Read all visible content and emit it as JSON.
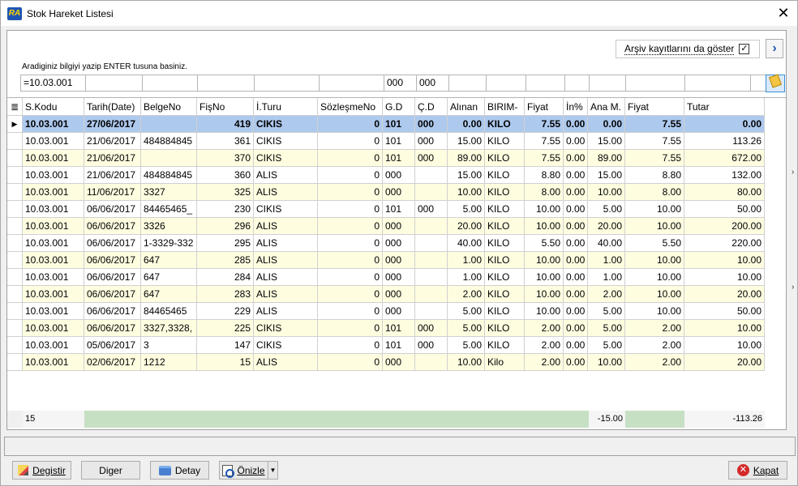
{
  "window": {
    "title": "Stok Hareket Listesi",
    "logo_text": "RA"
  },
  "archive": {
    "label": "Arşiv kayıtlarını da göster",
    "checked_glyph": "☑"
  },
  "hint": "Aradiginiz bilgiyi yazip ENTER tusuna basiniz.",
  "filters": [
    "=10.03.001",
    "",
    "",
    "",
    "",
    "",
    "000",
    "000",
    "",
    "",
    "",
    "",
    "",
    "",
    "",
    ""
  ],
  "columns": [
    "S.Kodu",
    "Tarih(Date)",
    "BelgeNo",
    "FişNo",
    "İ.Turu",
    "SözleşmeNo",
    "G.D",
    "Ç.D",
    "Alınan",
    "BIRIM-",
    "Fiyat",
    "İn%",
    "Ana M.",
    "Fiyat",
    "Tutar"
  ],
  "rows": [
    [
      "10.03.001",
      "27/06/2017",
      "",
      "419",
      "CIKIS",
      "0",
      "101",
      "000",
      "0.00",
      "KILO",
      "7.55",
      "0.00",
      "0.00",
      "7.55",
      "0.00"
    ],
    [
      "10.03.001",
      "21/06/2017",
      "484884845",
      "361",
      "CIKIS",
      "0",
      "101",
      "000",
      "15.00",
      "KILO",
      "7.55",
      "0.00",
      "15.00",
      "7.55",
      "113.26"
    ],
    [
      "10.03.001",
      "21/06/2017",
      "",
      "370",
      "CIKIS",
      "0",
      "101",
      "000",
      "89.00",
      "KILO",
      "7.55",
      "0.00",
      "89.00",
      "7.55",
      "672.00"
    ],
    [
      "10.03.001",
      "21/06/2017",
      "484884845",
      "360",
      "ALIS",
      "0",
      "000",
      "",
      "15.00",
      "KILO",
      "8.80",
      "0.00",
      "15.00",
      "8.80",
      "132.00"
    ],
    [
      "10.03.001",
      "11/06/2017",
      "3327",
      "325",
      "ALIS",
      "0",
      "000",
      "",
      "10.00",
      "KILO",
      "8.00",
      "0.00",
      "10.00",
      "8.00",
      "80.00"
    ],
    [
      "10.03.001",
      "06/06/2017",
      "84465465_",
      "230",
      "CIKIS",
      "0",
      "101",
      "000",
      "5.00",
      "KILO",
      "10.00",
      "0.00",
      "5.00",
      "10.00",
      "50.00"
    ],
    [
      "10.03.001",
      "06/06/2017",
      "3326",
      "296",
      "ALIS",
      "0",
      "000",
      "",
      "20.00",
      "KILO",
      "10.00",
      "0.00",
      "20.00",
      "10.00",
      "200.00"
    ],
    [
      "10.03.001",
      "06/06/2017",
      "1-3329-332",
      "295",
      "ALIS",
      "0",
      "000",
      "",
      "40.00",
      "KILO",
      "5.50",
      "0.00",
      "40.00",
      "5.50",
      "220.00"
    ],
    [
      "10.03.001",
      "06/06/2017",
      "647",
      "285",
      "ALIS",
      "0",
      "000",
      "",
      "1.00",
      "KILO",
      "10.00",
      "0.00",
      "1.00",
      "10.00",
      "10.00"
    ],
    [
      "10.03.001",
      "06/06/2017",
      "647",
      "284",
      "ALIS",
      "0",
      "000",
      "",
      "1.00",
      "KILO",
      "10.00",
      "0.00",
      "1.00",
      "10.00",
      "10.00"
    ],
    [
      "10.03.001",
      "06/06/2017",
      "647",
      "283",
      "ALIS",
      "0",
      "000",
      "",
      "2.00",
      "KILO",
      "10.00",
      "0.00",
      "2.00",
      "10.00",
      "20.00"
    ],
    [
      "10.03.001",
      "06/06/2017",
      "84465465",
      "229",
      "ALIS",
      "0",
      "000",
      "",
      "5.00",
      "KILO",
      "10.00",
      "0.00",
      "5.00",
      "10.00",
      "50.00"
    ],
    [
      "10.03.001",
      "06/06/2017",
      "3327,3328,",
      "225",
      "CIKIS",
      "0",
      "101",
      "000",
      "5.00",
      "KILO",
      "2.00",
      "0.00",
      "5.00",
      "2.00",
      "10.00"
    ],
    [
      "10.03.001",
      "05/06/2017",
      "3",
      "147",
      "CIKIS",
      "0",
      "101",
      "000",
      "5.00",
      "KILO",
      "2.00",
      "0.00",
      "5.00",
      "2.00",
      "10.00"
    ],
    [
      "10.03.001",
      "02/06/2017",
      "1212",
      "15",
      "ALIS",
      "0",
      "000",
      "",
      "10.00",
      "Kilo",
      "2.00",
      "0.00",
      "10.00",
      "2.00",
      "20.00"
    ]
  ],
  "footer": {
    "count": "15",
    "ana_total": "-15.00",
    "tutar_total": "-113.26"
  },
  "buttons": {
    "degistir": "Degistir",
    "diger": "Diger",
    "detay": "Detay",
    "onizle": "Önizle",
    "kapat": "Kapat"
  },
  "colors": {
    "selected_row": "#aec9ee",
    "alt_row": "#fffde0",
    "footer_bar": "#c6e0c4"
  }
}
